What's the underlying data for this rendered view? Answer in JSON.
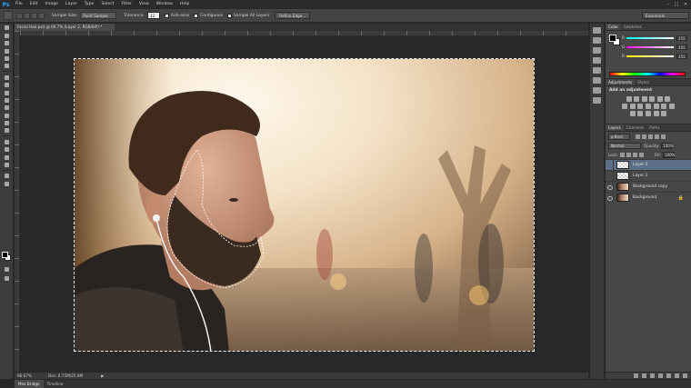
{
  "app": {
    "logo": "Ps",
    "menu": [
      "File",
      "Edit",
      "Image",
      "Layer",
      "Type",
      "Select",
      "Filter",
      "View",
      "Window",
      "Help"
    ],
    "window_controls": [
      "–",
      "□",
      "✕"
    ]
  },
  "options_bar": {
    "sample_size_label": "Sample Size:",
    "sample_size_value": "Point Sample",
    "tolerance_label": "Tolerance:",
    "tolerance_value": "32",
    "anti_alias_label": "Anti-alias",
    "contiguous_label": "Contiguous",
    "sample_all_layers_label": "Sample All Layers",
    "refine_edge_label": "Refine Edge...",
    "workspace": "Essentials"
  },
  "document": {
    "tab_title": "Facial Hair.psd @ 66.7% (Layer 2, RGB/8#) *",
    "zoom": "66.67%",
    "doc_size": "Doc: 6.75M/25.9M"
  },
  "bottom_tabs": [
    "Mini Bridge",
    "Timeline"
  ],
  "color_panel": {
    "tabs": [
      "Color",
      "Swatches"
    ],
    "channels": [
      {
        "label": "R",
        "value": "255"
      },
      {
        "label": "G",
        "value": "255"
      },
      {
        "label": "B",
        "value": "255"
      }
    ]
  },
  "adjustments_panel": {
    "tabs": [
      "Adjustments",
      "Styles"
    ],
    "title": "Add an adjustment"
  },
  "layers_panel": {
    "tabs": [
      "Layers",
      "Channels",
      "Paths"
    ],
    "kind_filter": "ρ Kind",
    "blend_mode": "Normal",
    "opacity_label": "Opacity:",
    "opacity_value": "100%",
    "lock_label": "Lock:",
    "fill_label": "Fill:",
    "fill_value": "100%",
    "layers": [
      {
        "name": "Layer 2",
        "visible": false,
        "active": true
      },
      {
        "name": "Layer 1",
        "visible": false,
        "active": false
      },
      {
        "name": "Background copy",
        "visible": true,
        "active": false
      },
      {
        "name": "Background",
        "visible": true,
        "active": false,
        "locked": true
      }
    ]
  }
}
